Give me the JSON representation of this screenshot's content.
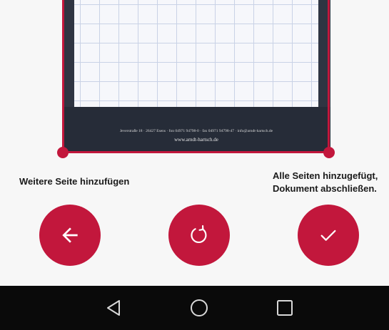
{
  "document_preview": {
    "footer_address": "Jeverstraße 18 · 26427 Esens · fon 04971 94798-0 · fax 04971 94798-47 · info@arndt-hartsch.de",
    "footer_website": "www.arndt-hartsch.de"
  },
  "actions": {
    "add_page_label": "Weitere Seite hinzufügen",
    "finish_label_line1": "Alle Seiten hinzugefügt,",
    "finish_label_line2": "Dokument abschließen."
  },
  "icons": {
    "back_button": "arrow-left-icon",
    "rotate_button": "rotate-icon",
    "done_button": "checkmark-icon",
    "nav_back": "triangle-back-icon",
    "nav_home": "circle-home-icon",
    "nav_recents": "square-recents-icon"
  },
  "colors": {
    "accent": "#c2173c",
    "navbar": "#0a0a0a",
    "background": "#f7f7f7"
  }
}
